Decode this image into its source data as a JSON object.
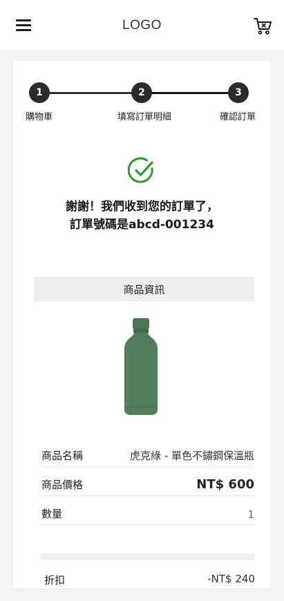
{
  "header": {
    "logo": "LOGO"
  },
  "steps": [
    {
      "number": "1",
      "label": "購物車"
    },
    {
      "number": "2",
      "label": "填寫訂單明細"
    },
    {
      "number": "3",
      "label": "確認訂單"
    }
  ],
  "confirmation": {
    "line1": "謝謝！我們收到您的訂單了，",
    "line2": "訂單號碼是abcd-001234"
  },
  "product": {
    "section_title": "商品資訊",
    "rows": [
      {
        "key": "商品名稱",
        "value": "虎克綠 - 單色不鏽鋼保溫瓶"
      },
      {
        "key": "商品價格",
        "value": "NT$ 600"
      },
      {
        "key": "數量",
        "value": "1"
      }
    ]
  },
  "discount": {
    "label": "折扣",
    "value": "-NT$ 240"
  },
  "colors": {
    "accent_check": "#2e9a2e",
    "bottle": "#4f7d5c",
    "step_circle": "#2b2b2b"
  },
  "icons": {
    "menu": "hamburger-menu-icon",
    "cart": "shopping-cart-icon",
    "success": "check-circle-icon"
  }
}
